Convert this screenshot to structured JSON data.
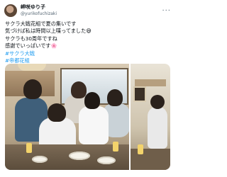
{
  "header": {
    "display_name": "岬咲ゆり子",
    "handle": "@yurikofuchizaki",
    "more": "···"
  },
  "post": {
    "lines": [
      "サクラ大戦花組で夏の集いです",
      "気づけば私は時間以上喋ってました😅",
      "サクラも30周年ですね",
      "感謝でいっぱいです🌸"
    ],
    "hashtags": [
      "#サクラ大戦",
      "#帝都花組"
    ]
  },
  "media": {
    "photo_count": 2
  }
}
